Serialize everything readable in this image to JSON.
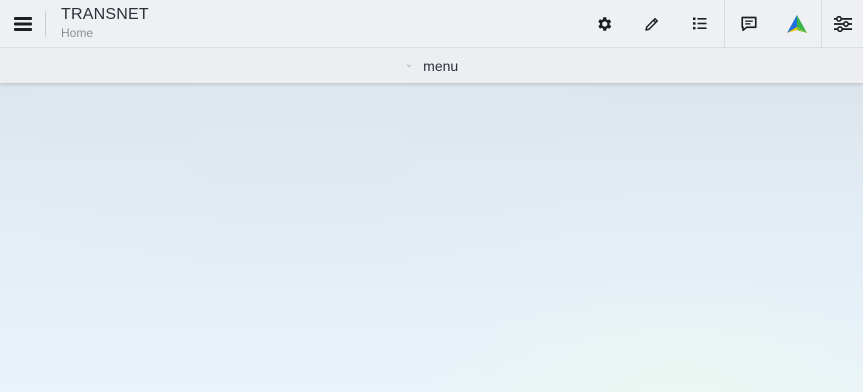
{
  "header": {
    "app_title": "TRANSNET",
    "breadcrumb": "Home",
    "icons": [
      "menu-icon",
      "settings-icon",
      "edit-icon",
      "list-icon",
      "chat-icon",
      "app-logo-icon",
      "filters-icon"
    ]
  },
  "menubar": {
    "toggle_label": "menu",
    "chevron": "chevron-down-icon"
  },
  "colors": {
    "topbar_bg": "#eef0f4",
    "icon_color": "#1d1f24",
    "logo_blue": "#1e6fd9",
    "logo_green": "#39b54a",
    "logo_yellow": "#f4c400"
  }
}
